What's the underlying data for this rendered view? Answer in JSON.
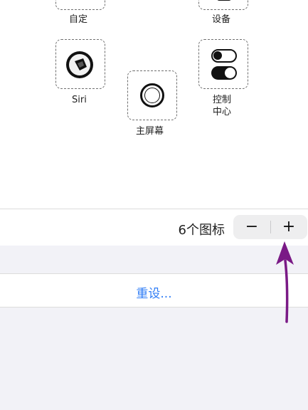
{
  "icons": {
    "custom": {
      "label": "自定"
    },
    "device": {
      "label": "设备"
    },
    "siri": {
      "label": "Siri"
    },
    "home": {
      "label": "主屏幕"
    },
    "control_center": {
      "label_line1": "控制",
      "label_line2": "中心"
    }
  },
  "icon_count": {
    "label": "6个图标",
    "decrement_symbol": "−",
    "increment_symbol": "+"
  },
  "reset": {
    "label": "重设..."
  },
  "colors": {
    "link": "#2e7cf6",
    "arrow": "#7a1a86",
    "group_background": "#f2f2f7"
  }
}
